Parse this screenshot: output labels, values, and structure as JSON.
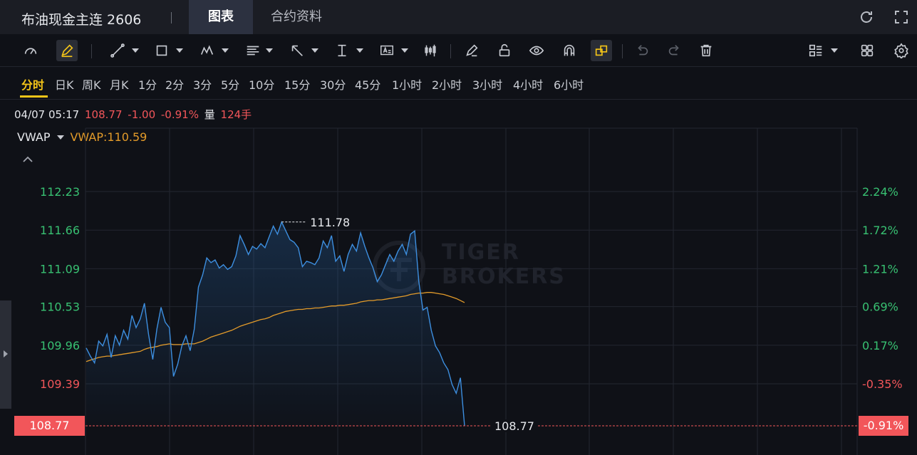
{
  "title": "布油现金主连 2606",
  "tabs": [
    {
      "label": "图表",
      "active": true
    },
    {
      "label": "合约资料",
      "active": false
    }
  ],
  "header_icons": [
    "refresh-icon",
    "fullscreen-icon"
  ],
  "toolbar_icons": [
    "crosshair-speed-icon",
    "pen-icon",
    "trendline-icon",
    "rectangle-icon",
    "pattern-icon",
    "fibonacci-icon",
    "arrow-icon",
    "vertical-range-icon",
    "text-icon",
    "candle-icon",
    "eraser-icon",
    "unlock-icon",
    "eye-icon",
    "magnet-icon",
    "link-icon",
    "undo-icon",
    "redo-icon",
    "trash-icon",
    "layout-list-icon",
    "grid-icon",
    "settings-icon"
  ],
  "periods": [
    "分时",
    "日K",
    "周K",
    "月K",
    "1分",
    "2分",
    "3分",
    "5分",
    "10分",
    "15分",
    "30分",
    "45分",
    "1小时",
    "2小时",
    "3小时",
    "4小时",
    "6小时"
  ],
  "active_period": "分时",
  "info": {
    "datetime": "04/07 05:17",
    "price": "108.77",
    "change": "-1.00",
    "change_pct": "-0.91%",
    "volume_label": "量",
    "volume": "124手"
  },
  "indicator": {
    "name": "VWAP",
    "value_label": "VWAP:110.59"
  },
  "watermark": [
    "TIGER",
    "BROKERS"
  ],
  "colors": {
    "price_line": "#3d8fe0",
    "vwap_line": "#e39b2a",
    "up": "#38c172",
    "down": "#f2565a",
    "accent": "#f5c518"
  },
  "chart_data": {
    "type": "line",
    "series": [
      {
        "name": "价格",
        "values": [
          109.92,
          109.8,
          109.7,
          110.02,
          109.95,
          110.12,
          109.78,
          110.1,
          109.96,
          110.18,
          110.05,
          110.4,
          110.22,
          110.35,
          110.58,
          110.12,
          109.75,
          110.2,
          110.52,
          110.3,
          110.22,
          109.5,
          109.68,
          109.95,
          110.1,
          109.88,
          110.2,
          110.82,
          111.0,
          111.25,
          111.18,
          111.22,
          111.1,
          111.15,
          111.08,
          111.12,
          111.28,
          111.58,
          111.45,
          111.3,
          111.42,
          111.38,
          111.46,
          111.4,
          111.56,
          111.72,
          111.6,
          111.78,
          111.65,
          111.52,
          111.48,
          111.4,
          111.12,
          111.2,
          111.18,
          111.15,
          111.25,
          111.5,
          111.4,
          111.58,
          111.2,
          111.28,
          111.05,
          111.3,
          111.45,
          111.35,
          111.62,
          111.42,
          111.25,
          111.1,
          110.9,
          111.0,
          111.15,
          111.3,
          111.2,
          111.35,
          111.45,
          111.3,
          111.6,
          111.65,
          110.9,
          110.48,
          110.52,
          110.18,
          109.95,
          109.85,
          109.7,
          109.6,
          109.38,
          109.25,
          109.48,
          108.77
        ]
      },
      {
        "name": "VWAP",
        "values": [
          109.72,
          109.74,
          109.76,
          109.78,
          109.79,
          109.8,
          109.8,
          109.81,
          109.82,
          109.83,
          109.84,
          109.85,
          109.86,
          109.87,
          109.9,
          109.92,
          109.93,
          109.94,
          109.96,
          109.97,
          109.98,
          109.97,
          109.97,
          109.97,
          109.98,
          109.98,
          109.98,
          110.0,
          110.02,
          110.05,
          110.08,
          110.1,
          110.12,
          110.14,
          110.16,
          110.18,
          110.21,
          110.24,
          110.26,
          110.28,
          110.3,
          110.32,
          110.34,
          110.35,
          110.37,
          110.4,
          110.42,
          110.44,
          110.46,
          110.47,
          110.48,
          110.49,
          110.49,
          110.5,
          110.5,
          110.51,
          110.51,
          110.52,
          110.53,
          110.54,
          110.54,
          110.55,
          110.55,
          110.56,
          110.57,
          110.58,
          110.6,
          110.61,
          110.62,
          110.62,
          110.63,
          110.63,
          110.64,
          110.65,
          110.66,
          110.67,
          110.68,
          110.69,
          110.71,
          110.72,
          110.73,
          110.73,
          110.74,
          110.74,
          110.73,
          110.72,
          110.71,
          110.69,
          110.67,
          110.65,
          110.62,
          110.59
        ]
      }
    ],
    "ylim": [
      108.2,
      112.8
    ],
    "y_ticks_left": [
      "112.23",
      "111.66",
      "111.09",
      "110.53",
      "109.96",
      "109.39",
      "108.77"
    ],
    "y_ticks_right": [
      "2.24%",
      "1.72%",
      "1.21%",
      "0.69%",
      "0.17%",
      "-0.35%",
      "-0.91%"
    ],
    "y_tick_values": [
      112.23,
      111.66,
      111.09,
      110.53,
      109.96,
      109.39,
      108.77
    ],
    "y_tick_colors": [
      "up",
      "up",
      "up",
      "up",
      "up",
      "down",
      "down"
    ],
    "last_price": 108.77,
    "last_price_label": "108.77",
    "last_change_pct_label": "-0.91%",
    "high_annotation": {
      "value": 111.78,
      "label": "111.78"
    },
    "grid": true,
    "x_capacity": 170
  }
}
